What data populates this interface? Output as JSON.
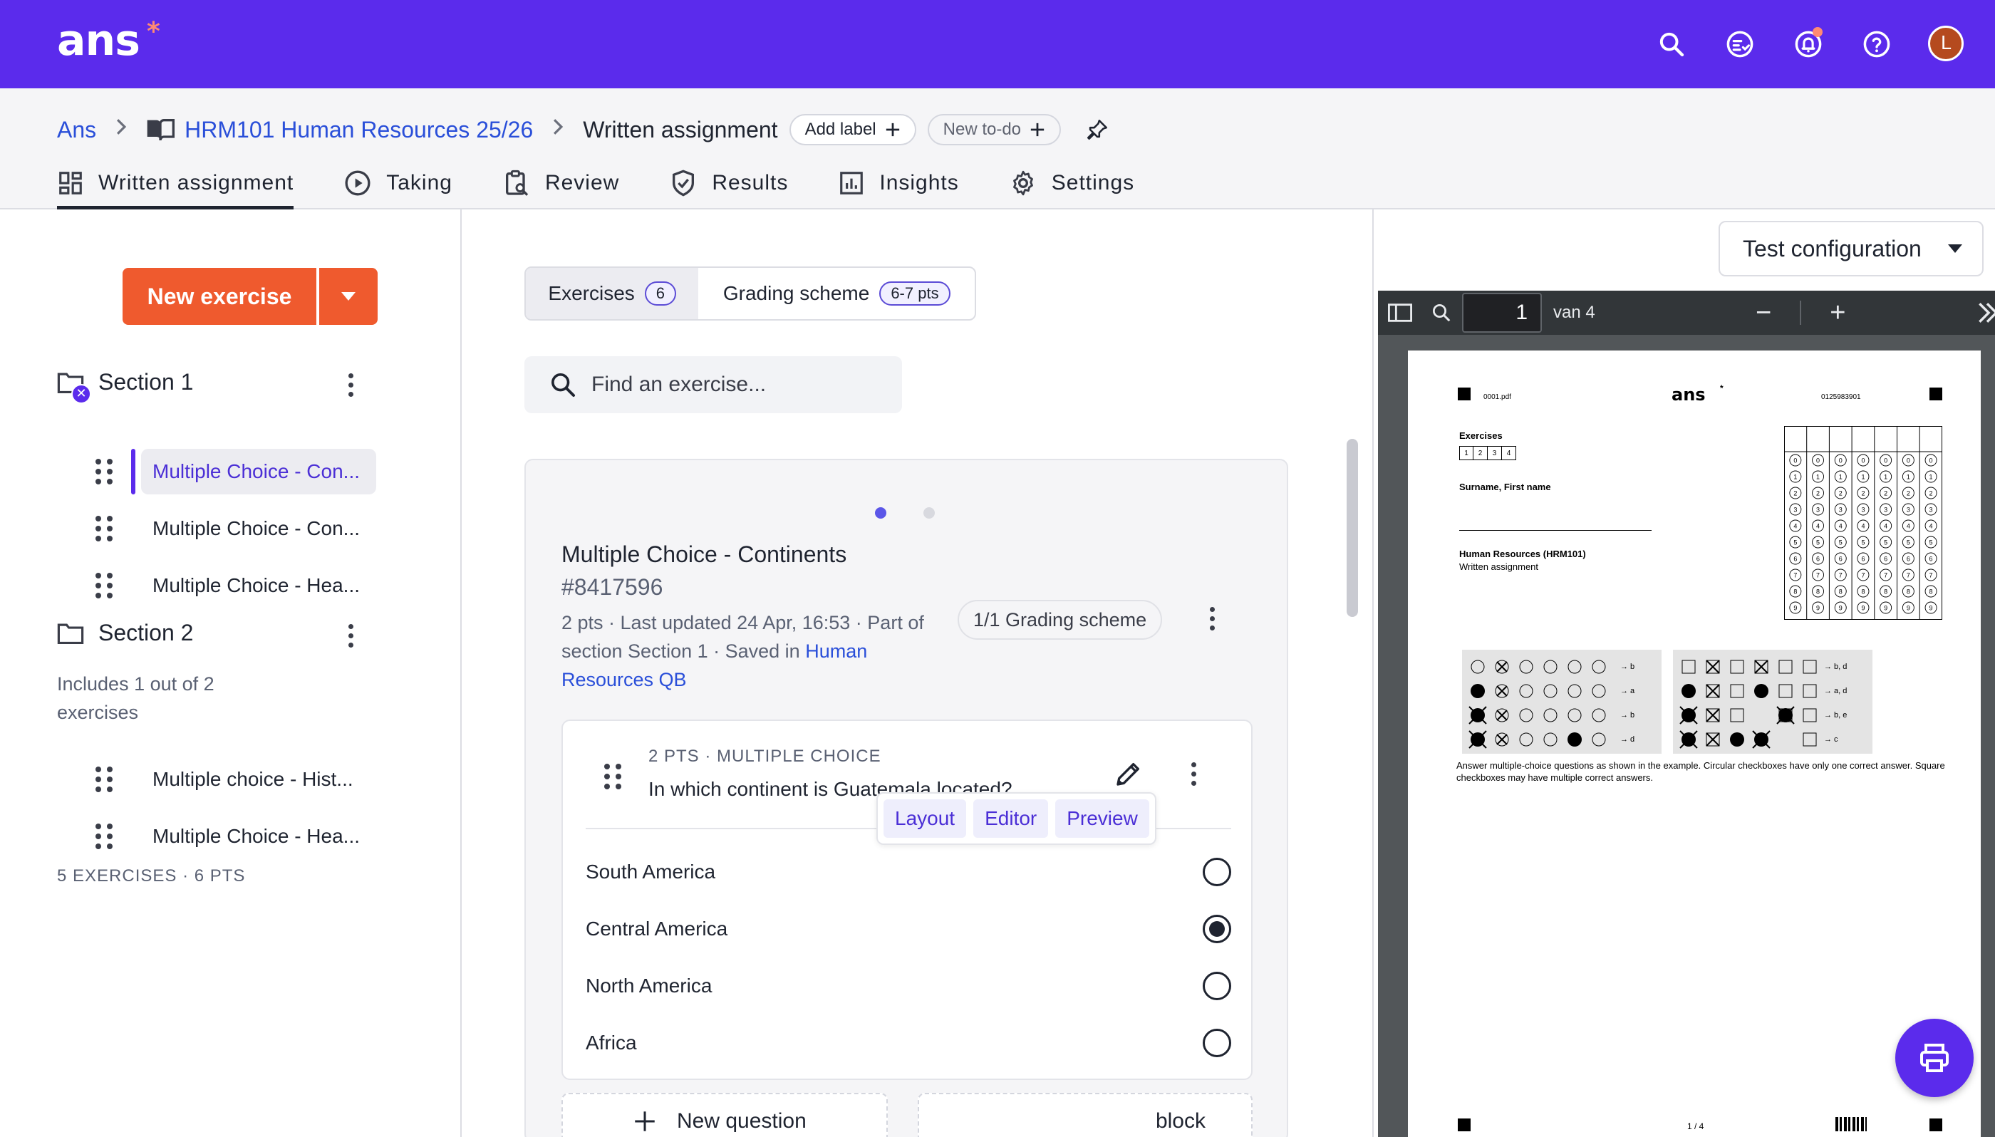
{
  "topbar": {
    "logo": "ans",
    "logo_star": "*",
    "avatar_initial": "L",
    "colors": {
      "bar": "#5b2bec",
      "accent": "#ef5a2e"
    },
    "icons": [
      "search-icon",
      "tasks-icon",
      "bell-icon",
      "help-icon"
    ]
  },
  "breadcrumb": {
    "root": "Ans",
    "course": "HRM101 Human Resources 25/26",
    "current": "Written assignment",
    "add_label": "Add label",
    "new_todo": "New to-do"
  },
  "tabs": [
    {
      "label": "Written assignment",
      "icon": "dashboard-icon"
    },
    {
      "label": "Taking",
      "icon": "play-icon"
    },
    {
      "label": "Review",
      "icon": "review-icon"
    },
    {
      "label": "Results",
      "icon": "check-shield-icon"
    },
    {
      "label": "Insights",
      "icon": "chart-icon"
    },
    {
      "label": "Settings",
      "icon": "gear-icon"
    }
  ],
  "sidebar": {
    "new_exercise": "New exercise",
    "sections": [
      {
        "title": "Section 1",
        "items": [
          "Multiple Choice - Con...",
          "Multiple Choice - Con...",
          "Multiple Choice - Hea..."
        ]
      },
      {
        "title": "Section 2",
        "note": "Includes 1 out of 2 exercises",
        "items": [
          "Multiple choice - Hist...",
          "Multiple Choice - Hea..."
        ]
      }
    ],
    "summary": "5 EXERCISES · 6 PTS"
  },
  "center": {
    "seg_exercises": "Exercises",
    "seg_exercises_count": "6",
    "seg_grading": "Grading scheme",
    "seg_grading_pts": "6-7 pts",
    "search_placeholder": "Find an exercise...",
    "card": {
      "title": "Multiple Choice - Continents",
      "id": "#8417596",
      "meta": "2 pts · Last updated 24 Apr, 16:53 · Part of section Section 1 · Saved in",
      "link": "Human Resources QB",
      "grading_chip": "1/1 Grading scheme",
      "question": {
        "meta": "2 PTS · MULTIPLE CHOICE",
        "text": "In which continent is Guatemala located?",
        "options": [
          {
            "label": "South America",
            "checked": false
          },
          {
            "label": "Central America",
            "checked": true
          },
          {
            "label": "North America",
            "checked": false
          },
          {
            "label": "Africa",
            "checked": false
          }
        ]
      },
      "new_question": "New question",
      "new_block": "block"
    },
    "modes": [
      "Layout",
      "Editor",
      "Preview"
    ]
  },
  "right": {
    "test_config": "Test configuration",
    "pdf": {
      "page": "1",
      "of": "van 4",
      "file": "0001.pdf",
      "logo": "ans",
      "code": "0125983901",
      "exercises_label": "Exercises",
      "exercise_boxes": [
        "1",
        "2",
        "3",
        "4"
      ],
      "name_label": "Surname, First name",
      "course": "Human Resources (HRM101)",
      "assignment": "Written assignment",
      "example_answers_left": [
        "→ b",
        "→ a",
        "→ b",
        "→ d"
      ],
      "example_answers_right": [
        "→ b, d",
        "→ a, d",
        "→ b, e",
        "→ c"
      ],
      "instructions": "Answer multiple-choice questions as shown in the example. Circular checkboxes have only one correct answer. Square checkboxes may have multiple correct answers.",
      "footer": "1 / 4"
    }
  }
}
